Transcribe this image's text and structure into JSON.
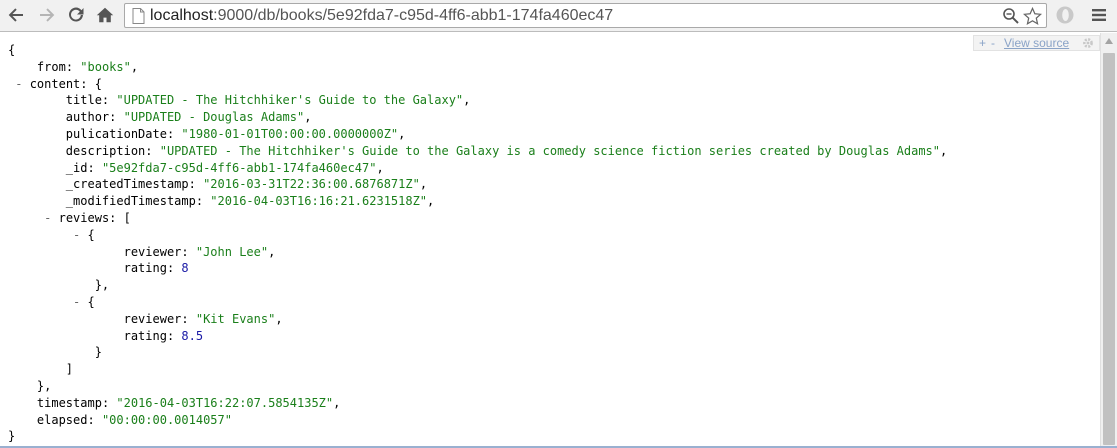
{
  "browser": {
    "url_host": "localhost",
    "url_path": ":9000/db/books/5e92fda7-c95d-4ff6-abb1-174fa460ec47",
    "icons": [
      "back-arrow-icon",
      "forward-arrow-icon",
      "reload-icon",
      "home-icon",
      "page-icon",
      "zoom-icon",
      "bookmark-star-icon",
      "opera-extension-icon",
      "menu-hamburger-icon"
    ]
  },
  "viewer": {
    "plus_label": "+",
    "minus_label": "-",
    "view_source_label": "View source",
    "gear_icon": "gear-icon"
  },
  "json": {
    "open_brace": "{",
    "close_brace": "}",
    "from_key": "from",
    "from_value": "\"books\"",
    "content_key": "content",
    "title_key": "title",
    "title_value": "\"UPDATED - The Hitchhiker's Guide to the Galaxy\"",
    "author_key": "author",
    "author_value": "\"UPDATED - Douglas Adams\"",
    "pub_key": "pulicationDate",
    "pub_value": "\"1980-01-01T00:00:00.0000000Z\"",
    "desc_key": "description",
    "desc_value": "\"UPDATED - The Hitchhiker's Guide to the Galaxy is a comedy science fiction series created by Douglas Adams\"",
    "id_key": "_id",
    "id_value": "\"5e92fda7-c95d-4ff6-abb1-174fa460ec47\"",
    "created_key": "_createdTimestamp",
    "created_value": "\"2016-03-31T22:36:00.6876871Z\"",
    "modified_key": "_modifiedTimestamp",
    "modified_value": "\"2016-04-03T16:16:21.6231518Z\"",
    "reviews_key": "reviews",
    "reviews": [
      {
        "reviewer_key": "reviewer",
        "reviewer_value": "\"John Lee\"",
        "rating_key": "rating",
        "rating_value": "8"
      },
      {
        "reviewer_key": "reviewer",
        "reviewer_value": "\"Kit Evans\"",
        "rating_key": "rating",
        "rating_value": "8.5"
      }
    ],
    "timestamp_key": "timestamp",
    "timestamp_value": "\"2016-04-03T16:22:07.5854135Z\"",
    "elapsed_key": "elapsed",
    "elapsed_value": "\"00:00:00.0014057\""
  }
}
